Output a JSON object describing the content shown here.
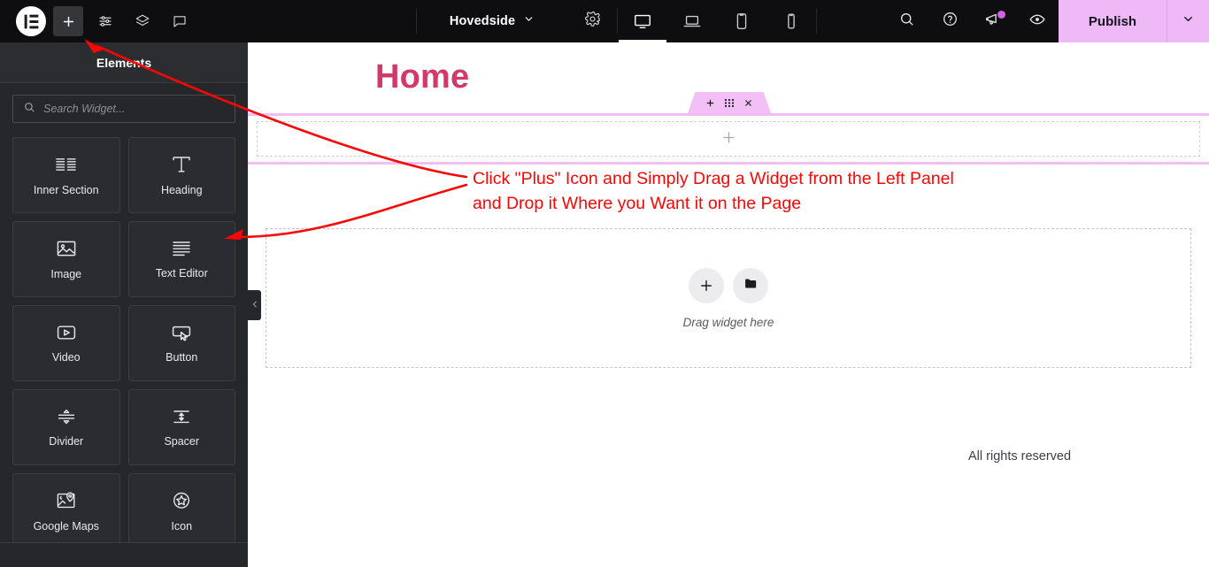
{
  "topbar": {
    "logo_icon": "elementor-logo-icon",
    "add_icon": "plus-icon",
    "settings_sliders_icon": "sliders-icon",
    "layers_icon": "layers-icon",
    "comment_icon": "comment-icon",
    "document_name": "Hovedside",
    "document_caret_icon": "chevron-down-icon",
    "gear_icon": "gear-icon",
    "devices": [
      {
        "name": "desktop",
        "icon": "desktop-icon",
        "active": true
      },
      {
        "name": "laptop",
        "icon": "laptop-icon",
        "active": false
      },
      {
        "name": "tablet",
        "icon": "tablet-icon",
        "active": false
      },
      {
        "name": "mobile",
        "icon": "mobile-icon",
        "active": false
      }
    ],
    "search_icon": "search-icon",
    "help_icon": "question-circle-icon",
    "megaphone_icon": "megaphone-icon",
    "has_notification": true,
    "preview_icon": "eye-icon",
    "publish_label": "Publish",
    "publish_caret_icon": "chevron-down-icon",
    "publish_bg": "#EFB8F7",
    "bar_bg": "#0E0E11"
  },
  "panel": {
    "title": "Elements",
    "search": {
      "placeholder": "Search Widget...",
      "value": "",
      "icon": "search-icon"
    },
    "widgets": [
      {
        "label": "Inner Section",
        "icon": "inner-section-icon"
      },
      {
        "label": "Heading",
        "icon": "heading-icon"
      },
      {
        "label": "Image",
        "icon": "image-icon"
      },
      {
        "label": "Text Editor",
        "icon": "text-editor-icon"
      },
      {
        "label": "Video",
        "icon": "video-icon"
      },
      {
        "label": "Button",
        "icon": "button-icon"
      },
      {
        "label": "Divider",
        "icon": "divider-icon"
      },
      {
        "label": "Spacer",
        "icon": "spacer-icon"
      },
      {
        "label": "Google Maps",
        "icon": "google-maps-icon"
      },
      {
        "label": "Icon",
        "icon": "star-icon"
      }
    ],
    "collapse_icon": "chevron-left-icon",
    "bg": "#26272B"
  },
  "canvas": {
    "page_title": "Home",
    "page_title_color": "#D2386A",
    "section_handle": {
      "add_icon": "plus-icon",
      "drag_icon": "drag-dots-icon",
      "close_icon": "close-icon",
      "bg": "#F2C0F7"
    },
    "empty_column_add_icon": "plus-icon",
    "dropzone": {
      "add_icon": "plus-icon",
      "folder_icon": "folder-icon",
      "text": "Drag widget here"
    },
    "footer_text": "All rights reserved"
  },
  "annotation": {
    "text": "Click \"Plus\" Icon and Simply Drag a Widget from the Left Panel\nand Drop it Where you Want it on the Page",
    "color": "#FB0505"
  }
}
